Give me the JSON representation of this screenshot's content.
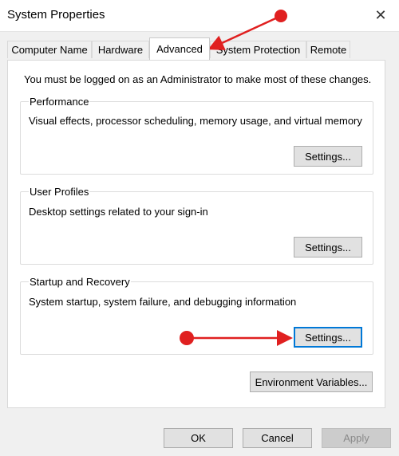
{
  "window": {
    "title": "System Properties",
    "close_glyph": "✕"
  },
  "tabs": [
    {
      "label": "Computer Name",
      "active": false
    },
    {
      "label": "Hardware",
      "active": false
    },
    {
      "label": "Advanced",
      "active": true
    },
    {
      "label": "System Protection",
      "active": false
    },
    {
      "label": "Remote",
      "active": false
    }
  ],
  "notice": "You must be logged on as an Administrator to make most of these changes.",
  "groups": {
    "performance": {
      "label": "Performance",
      "description": "Visual effects, processor scheduling, memory usage, and virtual memory",
      "button": "Settings..."
    },
    "user_profiles": {
      "label": "User Profiles",
      "description": "Desktop settings related to your sign-in",
      "button": "Settings..."
    },
    "startup_recovery": {
      "label": "Startup and Recovery",
      "description": "System startup, system failure, and debugging information",
      "button": "Settings..."
    }
  },
  "env_button": "Environment Variables...",
  "footer": {
    "ok": "OK",
    "cancel": "Cancel",
    "apply": "Apply"
  },
  "annotation_color": "#e02020",
  "icons": [
    "close-icon",
    "annotation-arrow-icon"
  ]
}
